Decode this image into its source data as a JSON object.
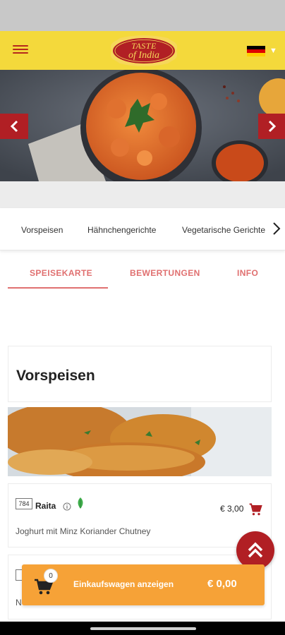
{
  "header": {
    "logo_line1": "TASTE",
    "logo_line2": "of India",
    "language_flag": "germany-flag"
  },
  "hero": {
    "prev_icon": "chevron-left-icon",
    "next_icon": "chevron-right-icon"
  },
  "categories": {
    "items": [
      "Vorspeisen",
      "Hähnchengerichte",
      "Vegetarische Gerichte"
    ],
    "more_icon": "chevron-right-icon"
  },
  "tabs": {
    "items": [
      "SPEISEKARTE",
      "BEWERTUNGEN",
      "INFO"
    ],
    "active": "SPEISEKARTE"
  },
  "section": {
    "title": "Vorspeisen"
  },
  "menu_items": [
    {
      "number": "784",
      "name": "Raita",
      "price": "€ 3,00",
      "description": "Joghurt mit Minz Koriander Chutney"
    },
    {
      "description": "N"
    }
  ],
  "cart": {
    "count": "0",
    "label": "Einkaufswagen anzeigen",
    "total": "€ 0,00"
  },
  "colors": {
    "header_bg": "#f4d93b",
    "brand_red": "#b11f24",
    "tab_accent": "#e07070",
    "cart_orange": "#f6a237"
  }
}
